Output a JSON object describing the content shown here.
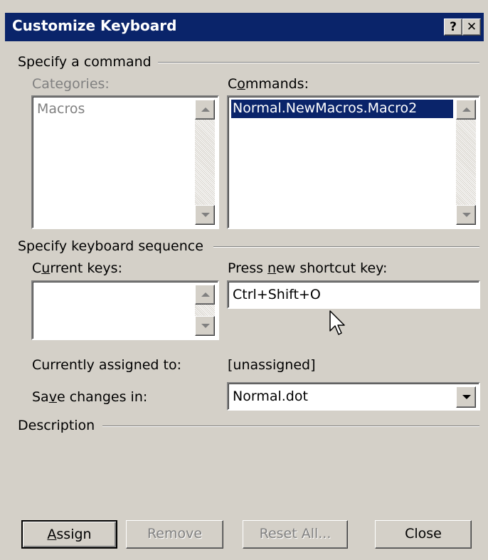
{
  "dialog": {
    "title": "Customize Keyboard",
    "help_button": "?",
    "close_button": "✕"
  },
  "specify_command": {
    "group_label": "Specify a command",
    "categories_label": "Categories:",
    "categories_items": [
      "Macros"
    ],
    "commands_label_pre": "C",
    "commands_label_ul": "o",
    "commands_label_post": "mmands:",
    "commands_items": [
      "Normal.NewMacros.Macro2"
    ]
  },
  "keyboard_sequence": {
    "group_label": "Specify keyboard sequence",
    "current_keys_label_pre": "C",
    "current_keys_label_ul": "u",
    "current_keys_label_post": "rrent keys:",
    "press_new_label_pre": "Press ",
    "press_new_label_ul": "n",
    "press_new_label_post": "ew shortcut key:",
    "new_shortcut_value": "Ctrl+Shift+O",
    "currently_assigned_label": "Currently assigned to:",
    "currently_assigned_value": "[unassigned]",
    "save_changes_label_pre": "Sa",
    "save_changes_label_ul": "v",
    "save_changes_label_post": "e changes in:",
    "save_changes_value": "Normal.dot"
  },
  "description": {
    "group_label": "Description"
  },
  "buttons": {
    "assign_ul": "A",
    "assign_post": "ssign",
    "remove": "Remove",
    "reset_all": "Reset All...",
    "close": "Close"
  },
  "colors": {
    "title_bar": "#0a246a",
    "selection": "#0a246a",
    "face": "#d4d0c8"
  }
}
